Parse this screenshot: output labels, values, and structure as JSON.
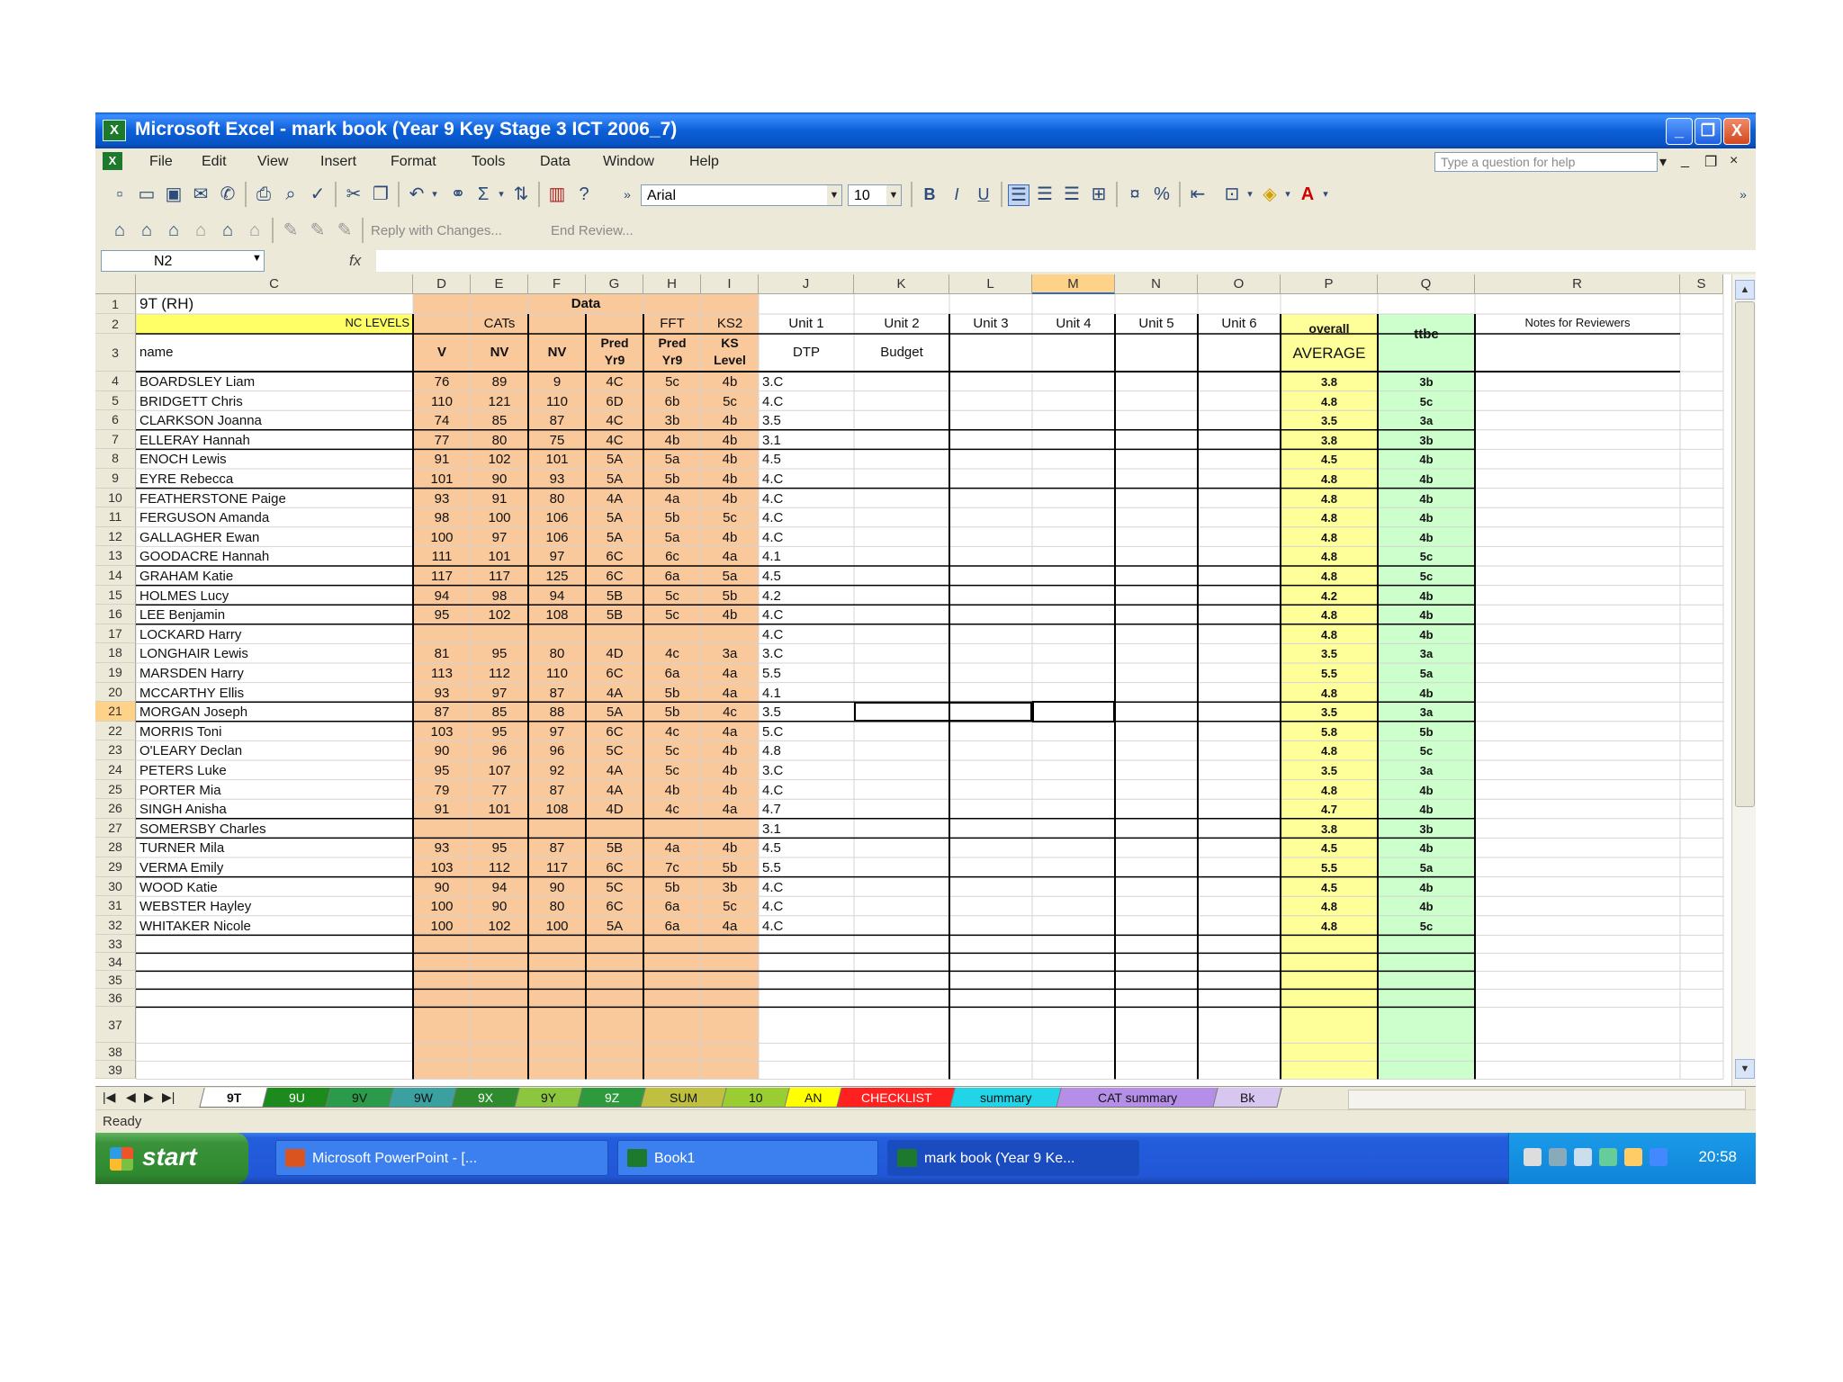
{
  "window": {
    "title": "Microsoft Excel - mark book (Year 9 Key Stage 3 ICT 2006_7)",
    "buttons": {
      "minimize": "_",
      "restore": "❐",
      "close": "X"
    }
  },
  "menu": {
    "items": [
      "File",
      "Edit",
      "View",
      "Insert",
      "Format",
      "Tools",
      "Data",
      "Window",
      "Help"
    ],
    "help_placeholder": "Type a question for help",
    "controls": [
      "▾",
      "_",
      "❐",
      "×"
    ]
  },
  "toolbar": {
    "font": "Arial",
    "font_size": "10",
    "bold": "B",
    "italic": "I",
    "underline": "U",
    "percent": "%",
    "reply_changes": "Reply with Changes...",
    "end_review": "End Review..."
  },
  "formula_bar": {
    "name_box": "N2",
    "fx": "fx",
    "content": ""
  },
  "columns": [
    {
      "label": "C",
      "w": 308
    },
    {
      "label": "D",
      "w": 64
    },
    {
      "label": "E",
      "w": 64
    },
    {
      "label": "F",
      "w": 64
    },
    {
      "label": "G",
      "w": 64
    },
    {
      "label": "H",
      "w": 64
    },
    {
      "label": "I",
      "w": 64
    },
    {
      "label": "J",
      "w": 212
    },
    {
      "label": "K",
      "w": 0
    },
    {
      "label": "L",
      "w": 92
    },
    {
      "label": "M",
      "w": 92
    },
    {
      "label": "N",
      "w": 92
    },
    {
      "label": "O",
      "w": 92
    },
    {
      "label": "P",
      "w": 108
    },
    {
      "label": "Q",
      "w": 108
    },
    {
      "label": "R",
      "w": 228
    },
    {
      "label": "S",
      "w": 48
    }
  ],
  "header_row1": {
    "class": "9T (RH)",
    "data": "Data"
  },
  "header_row2": {
    "levels": "NC LEVELS",
    "cats": "CATs",
    "fft": "FFT",
    "ks2": "KS2",
    "units": [
      "Unit 1",
      "Unit 2",
      "Unit 3",
      "Unit 4",
      "Unit 5",
      "Unit 6"
    ],
    "overall": "overall",
    "notes": "Notes for Reviewers"
  },
  "header_row3": {
    "name": "name",
    "cols": [
      "V",
      "NV",
      "NV"
    ],
    "pred_yr9": [
      "Pred",
      "Yr9"
    ],
    "pred_fft": [
      "Pred",
      "Yr9"
    ],
    "ks2_level": [
      "KS",
      "Level"
    ],
    "dtp": "DTP",
    "budget": "Budget",
    "average": "AVERAGE",
    "target": "ttbe"
  },
  "students": [
    {
      "r": "4",
      "name": "BOARDSLEY Liam",
      "v": "76",
      "n1": "89",
      "n2": "9",
      "pred": "4C",
      "fft": "5c",
      "ks": "4b",
      "u1": "3.C",
      "avg": "3.8",
      "t": "3b"
    },
    {
      "r": "5",
      "name": "BRIDGETT Chris",
      "v": "110",
      "n1": "121",
      "n2": "110",
      "pred": "6D",
      "fft": "6b",
      "ks": "5c",
      "u1": "4.C",
      "avg": "4.8",
      "t": "5c"
    },
    {
      "r": "6",
      "name": "CLARKSON Joanna",
      "v": "74",
      "n1": "85",
      "n2": "87",
      "pred": "4C",
      "fft": "3b",
      "ks": "4b",
      "u1": "3.5",
      "avg": "3.5",
      "t": "3a"
    },
    {
      "r": "7",
      "name": "ELLERAY Hannah",
      "v": "77",
      "n1": "80",
      "n2": "75",
      "pred": "4C",
      "fft": "4b",
      "ks": "4b",
      "u1": "3.1",
      "avg": "3.8",
      "t": "3b"
    },
    {
      "r": "8",
      "name": "ENOCH Lewis",
      "v": "91",
      "n1": "102",
      "n2": "101",
      "pred": "5A",
      "fft": "5a",
      "ks": "4b",
      "u1": "4.5",
      "avg": "4.5",
      "t": "4b"
    },
    {
      "r": "9",
      "name": "EYRE Rebecca",
      "v": "101",
      "n1": "90",
      "n2": "93",
      "pred": "5A",
      "fft": "5b",
      "ks": "4b",
      "u1": "4.C",
      "avg": "4.8",
      "t": "4b"
    },
    {
      "r": "10",
      "name": "FEATHERSTONE Paige",
      "v": "93",
      "n1": "91",
      "n2": "80",
      "pred": "4A",
      "fft": "4a",
      "ks": "4b",
      "u1": "4.C",
      "avg": "4.8",
      "t": "4b"
    },
    {
      "r": "11",
      "name": "FERGUSON Amanda",
      "v": "98",
      "n1": "100",
      "n2": "106",
      "pred": "5A",
      "fft": "5b",
      "ks": "5c",
      "u1": "4.C",
      "avg": "4.8",
      "t": "4b"
    },
    {
      "r": "12",
      "name": "GALLAGHER Ewan",
      "v": "100",
      "n1": "97",
      "n2": "106",
      "pred": "5A",
      "fft": "5a",
      "ks": "4b",
      "u1": "4.C",
      "avg": "4.8",
      "t": "4b"
    },
    {
      "r": "13",
      "name": "GOODACRE Hannah",
      "v": "111",
      "n1": "101",
      "n2": "97",
      "pred": "6C",
      "fft": "6c",
      "ks": "4a",
      "u1": "4.1",
      "avg": "4.8",
      "t": "5c"
    },
    {
      "r": "14",
      "name": "GRAHAM Katie",
      "v": "117",
      "n1": "117",
      "n2": "125",
      "pred": "6C",
      "fft": "6a",
      "ks": "5a",
      "u1": "4.5",
      "avg": "4.8",
      "t": "5c"
    },
    {
      "r": "15",
      "name": "HOLMES Lucy",
      "v": "94",
      "n1": "98",
      "n2": "94",
      "pred": "5B",
      "fft": "5c",
      "ks": "5b",
      "u1": "4.2",
      "avg": "4.2",
      "t": "4b"
    },
    {
      "r": "16",
      "name": "LEE Benjamin",
      "v": "95",
      "n1": "102",
      "n2": "108",
      "pred": "5B",
      "fft": "5c",
      "ks": "4b",
      "u1": "4.C",
      "avg": "4.8",
      "t": "4b"
    },
    {
      "r": "17",
      "name": "LOCKARD Harry",
      "v": "",
      "n1": "",
      "n2": "",
      "pred": "",
      "fft": "",
      "ks": "",
      "u1": "4.C",
      "avg": "4.8",
      "t": "4b"
    },
    {
      "r": "18",
      "name": "LONGHAIR Lewis",
      "v": "81",
      "n1": "95",
      "n2": "80",
      "pred": "4D",
      "fft": "4c",
      "ks": "3a",
      "u1": "3.C",
      "avg": "3.5",
      "t": "3a"
    },
    {
      "r": "19",
      "name": "MARSDEN Harry",
      "v": "113",
      "n1": "112",
      "n2": "110",
      "pred": "6C",
      "fft": "6a",
      "ks": "4a",
      "u1": "5.5",
      "avg": "5.5",
      "t": "5a"
    },
    {
      "r": "20",
      "name": "MCCARTHY Ellis",
      "v": "93",
      "n1": "97",
      "n2": "87",
      "pred": "4A",
      "fft": "5b",
      "ks": "4a",
      "u1": "4.1",
      "avg": "4.8",
      "t": "4b"
    },
    {
      "r": "21",
      "name": "MORGAN Joseph",
      "v": "87",
      "n1": "85",
      "n2": "88",
      "pred": "5A",
      "fft": "5b",
      "ks": "4c",
      "u1": "3.5",
      "avg": "3.5",
      "t": "3a"
    },
    {
      "r": "22",
      "name": "MORRIS Toni",
      "v": "103",
      "n1": "95",
      "n2": "97",
      "pred": "6C",
      "fft": "4c",
      "ks": "4a",
      "u1": "5.C",
      "avg": "5.8",
      "t": "5b"
    },
    {
      "r": "23",
      "name": "O'LEARY Declan",
      "v": "90",
      "n1": "96",
      "n2": "96",
      "pred": "5C",
      "fft": "5c",
      "ks": "4b",
      "u1": "4.8",
      "avg": "4.8",
      "t": "5c"
    },
    {
      "r": "24",
      "name": "PETERS Luke",
      "v": "95",
      "n1": "107",
      "n2": "92",
      "pred": "4A",
      "fft": "5c",
      "ks": "4b",
      "u1": "3.C",
      "avg": "3.5",
      "t": "3a"
    },
    {
      "r": "25",
      "name": "PORTER Mia",
      "v": "79",
      "n1": "77",
      "n2": "87",
      "pred": "4A",
      "fft": "4b",
      "ks": "4b",
      "u1": "4.C",
      "avg": "4.8",
      "t": "4b"
    },
    {
      "r": "26",
      "name": "SINGH Anisha",
      "v": "91",
      "n1": "101",
      "n2": "108",
      "pred": "4D",
      "fft": "4c",
      "ks": "4a",
      "u1": "4.7",
      "avg": "4.7",
      "t": "4b"
    },
    {
      "r": "27",
      "name": "SOMERSBY Charles",
      "v": "",
      "n1": "",
      "n2": "",
      "pred": "",
      "fft": "",
      "ks": "",
      "u1": "3.1",
      "avg": "3.8",
      "t": "3b"
    },
    {
      "r": "28",
      "name": "TURNER Mila",
      "v": "93",
      "n1": "95",
      "n2": "87",
      "pred": "5B",
      "fft": "4a",
      "ks": "4b",
      "u1": "4.5",
      "avg": "4.5",
      "t": "4b"
    },
    {
      "r": "29",
      "name": "VERMA Emily",
      "v": "103",
      "n1": "112",
      "n2": "117",
      "pred": "6C",
      "fft": "7c",
      "ks": "5b",
      "u1": "5.5",
      "avg": "5.5",
      "t": "5a"
    },
    {
      "r": "30",
      "name": "WOOD Katie",
      "v": "90",
      "n1": "94",
      "n2": "90",
      "pred": "5C",
      "fft": "5b",
      "ks": "3b",
      "u1": "4.C",
      "avg": "4.5",
      "t": "4b"
    },
    {
      "r": "31",
      "name": "WEBSTER Hayley",
      "v": "100",
      "n1": "90",
      "n2": "80",
      "pred": "6C",
      "fft": "6a",
      "ks": "5c",
      "u1": "4.C",
      "avg": "4.8",
      "t": "4b"
    },
    {
      "r": "32",
      "name": "WHITAKER Nicole",
      "v": "100",
      "n1": "102",
      "n2": "100",
      "pred": "5A",
      "fft": "6a",
      "ks": "4a",
      "u1": "4.C",
      "avg": "4.8",
      "t": "5c"
    }
  ],
  "empty_rows": [
    "33",
    "34",
    "35",
    "36",
    "37",
    "38",
    "39"
  ],
  "sheet_tabs": [
    {
      "label": "9T",
      "color": "#ffffff"
    },
    {
      "label": "9U",
      "color": "#1c8a1c"
    },
    {
      "label": "9V",
      "color": "#2b9a4a"
    },
    {
      "label": "9W",
      "color": "#3aa0a0"
    },
    {
      "label": "9X",
      "color": "#2e8b2e"
    },
    {
      "label": "9Y",
      "color": "#8cc63f"
    },
    {
      "label": "9Z",
      "color": "#2e9a3e"
    },
    {
      "label": "SUM",
      "color": "#c0c040"
    },
    {
      "label": "10",
      "color": "#9acd32"
    },
    {
      "label": "AN",
      "color": "#ffff00"
    },
    {
      "label": "CHECKLIST",
      "color": "#ff2020"
    },
    {
      "label": "summary",
      "color": "#22d4e8"
    },
    {
      "label": "CAT summary",
      "color": "#b58ee8"
    },
    {
      "label": "Bk",
      "color": "#d6c6f0"
    }
  ],
  "tab_nav": [
    "|◀",
    "◀",
    "▶",
    "▶|"
  ],
  "status": {
    "text": "Ready"
  },
  "taskbar": {
    "start": "start",
    "tasks": [
      {
        "label": "Microsoft PowerPoint - [...",
        "icon_color": "#d9541f"
      },
      {
        "label": "Book1",
        "icon_color": "#1d7a2c"
      },
      {
        "label": "mark book (Year 9 Ke...",
        "icon_color": "#1d7a2c"
      }
    ],
    "clock": "20:58"
  },
  "colors": {
    "orange_band": "#f9c89b",
    "yellow_band": "#ffff99",
    "green_band": "#ccffcc",
    "levels_yellow": "#ffff66"
  }
}
